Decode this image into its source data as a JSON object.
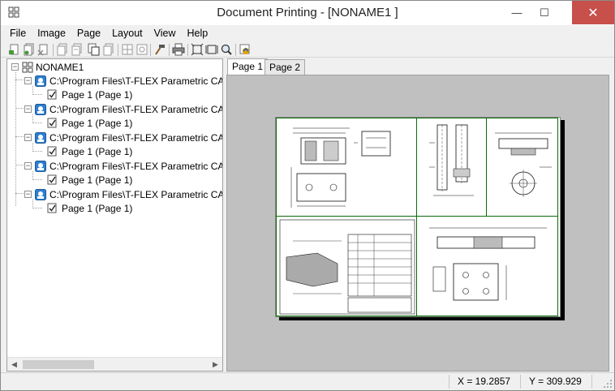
{
  "window": {
    "title": "Document Printing - [NONAME1 ]",
    "minimize_glyph": "—",
    "maximize_glyph": "☐",
    "close_glyph": "✕"
  },
  "menu": {
    "items": [
      "File",
      "Image",
      "Page",
      "Layout",
      "View",
      "Help"
    ]
  },
  "toolbar": {
    "icons": [
      "add-image-icon",
      "add-image-2-icon",
      "delete-image-icon",
      "page-copy-icon",
      "new-page-icon",
      "page-stack-icon",
      "page-duplicate-icon",
      "page-remove-icon",
      "layout-grid-icon",
      "layout-auto-icon",
      "hammer-icon",
      "print-icon",
      "fit-page-icon",
      "fit-width-icon",
      "zoom-icon",
      "refresh-icon"
    ]
  },
  "tree": {
    "root_label": "NONAME1",
    "documents": [
      {
        "path": "C:\\Program Files\\T-FLEX Parametric CAD",
        "page": "Page 1 (Page 1)"
      },
      {
        "path": "C:\\Program Files\\T-FLEX Parametric CAD",
        "page": "Page 1 (Page 1)"
      },
      {
        "path": "C:\\Program Files\\T-FLEX Parametric CAD",
        "page": "Page 1 (Page 1)"
      },
      {
        "path": "C:\\Program Files\\T-FLEX Parametric CAD",
        "page": "Page 1 (Page 1)"
      },
      {
        "path": "C:\\Program Files\\T-FLEX Parametric CAD",
        "page": "Page 1 (Page 1)"
      }
    ]
  },
  "tabs": [
    "Page 1",
    "Page 2"
  ],
  "active_tab": "Page 1",
  "status": {
    "x_label": "X = 19.2857",
    "y_label": "Y = 309.929"
  },
  "colors": {
    "frame_green": "#0a6a0a",
    "canvas_gray": "#c0c0c0",
    "close_red": "#c7504b"
  }
}
